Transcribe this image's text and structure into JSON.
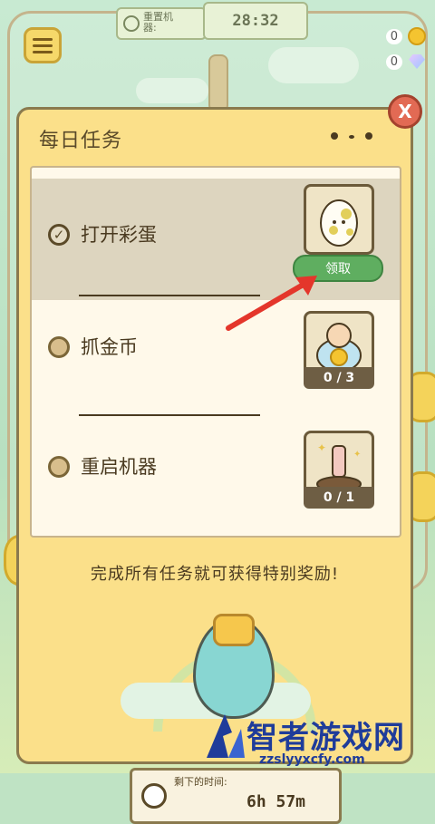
{
  "hud": {
    "reset_label": "重置机器:",
    "timer": "28:32",
    "coins": "0",
    "gems": "0"
  },
  "dialog": {
    "title": "每日任务",
    "close": "X",
    "tasks": [
      {
        "label": "打开彩蛋",
        "status": "done",
        "claim_label": "领取",
        "check": "✓"
      },
      {
        "label": "抓金币",
        "status": "progress",
        "progress": "0 / 3"
      },
      {
        "label": "重启机器",
        "status": "progress",
        "progress": "0 / 1"
      }
    ],
    "footer": "完成所有任务就可获得特别奖励!",
    "remaining_label": "剩下的时间:",
    "remaining_value": "6h 57m"
  },
  "watermark": {
    "name": "智者游戏网",
    "url": "zzslyyxcfy.com"
  },
  "colors": {
    "dialog_bg": "#fbe08a",
    "claim_button": "#5fae60",
    "close_button": "#e26a54",
    "arrow": "#e4362b"
  }
}
